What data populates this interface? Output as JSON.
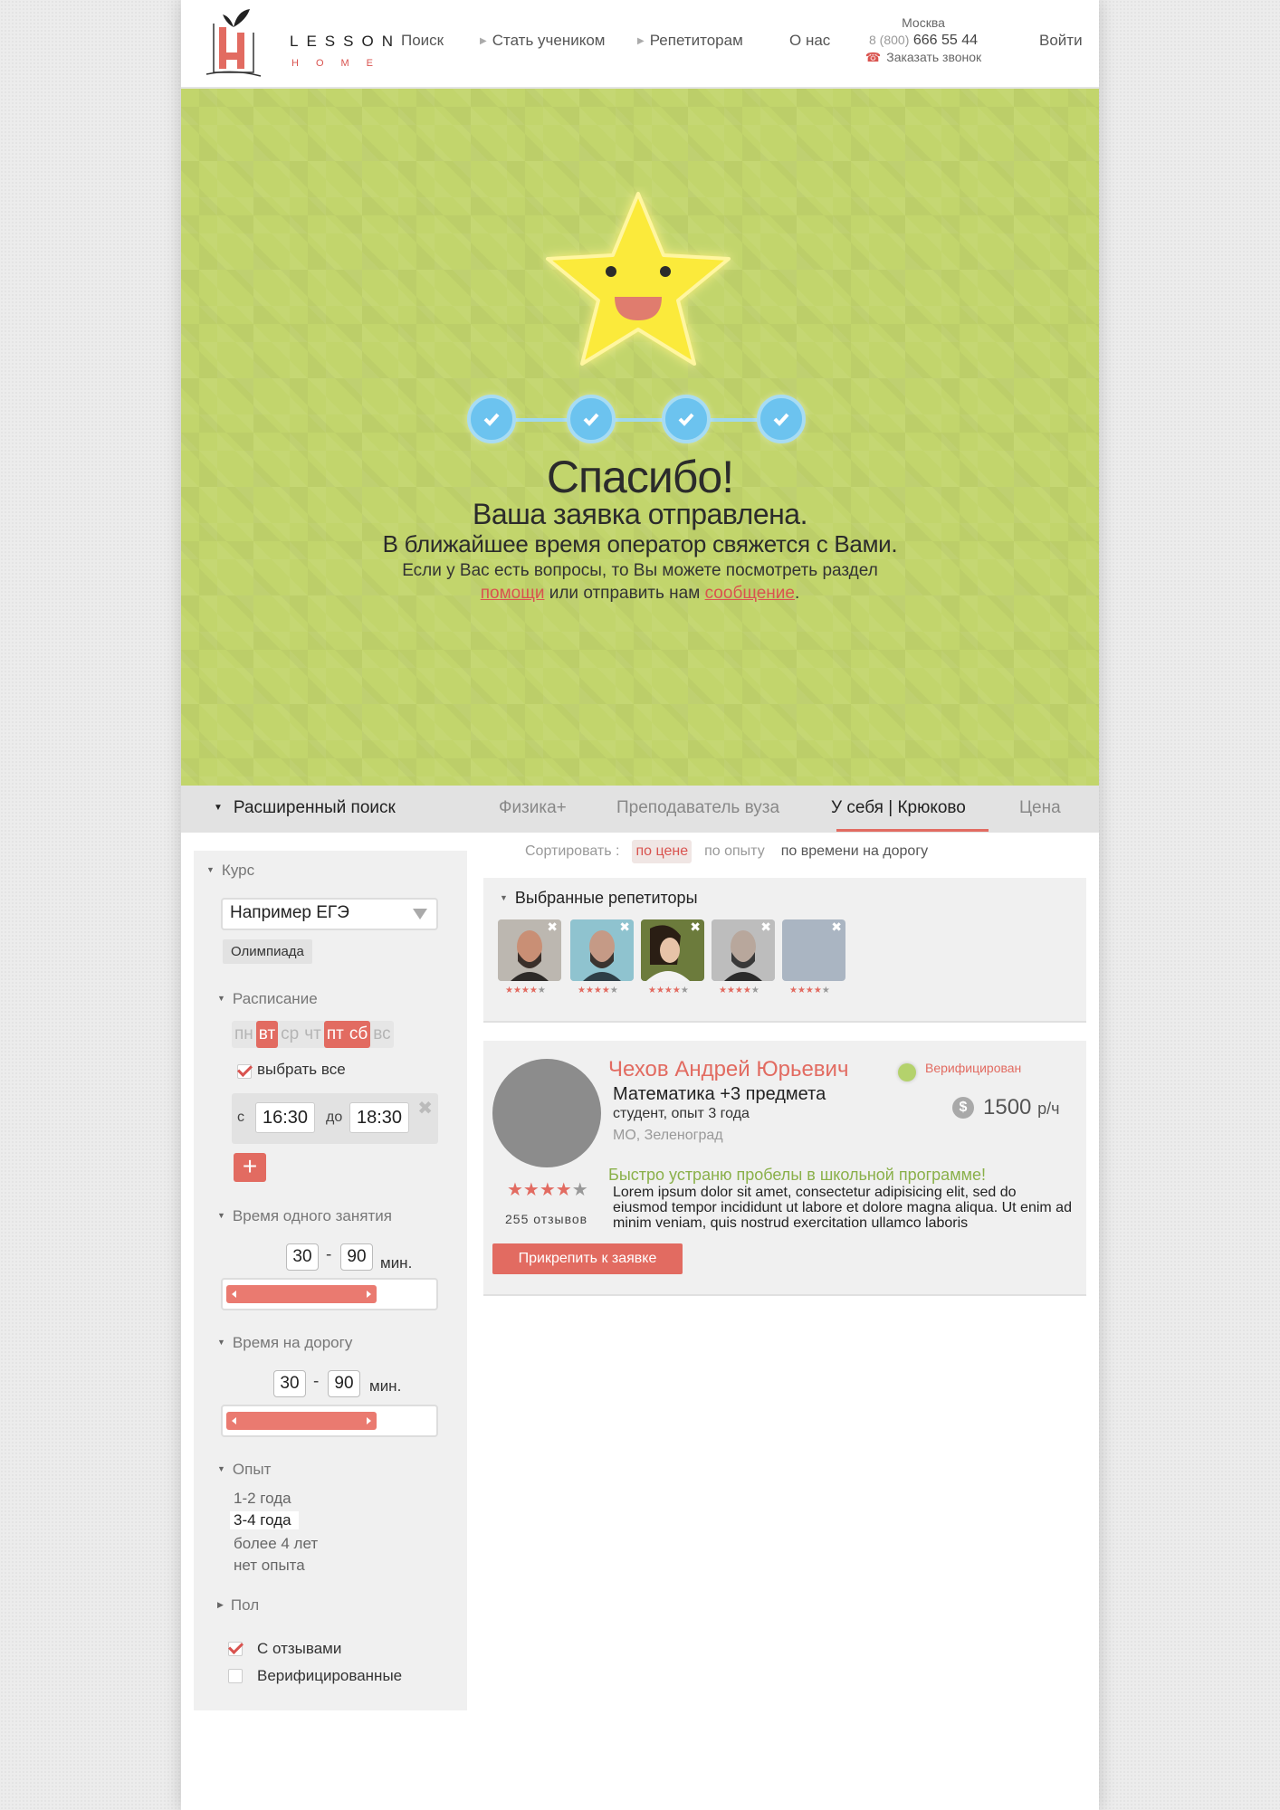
{
  "header": {
    "logo_line1": "LESSON",
    "logo_line2": "HOME",
    "nav": {
      "search": "Поиск",
      "become_student": "Стать учеником",
      "tutors": "Репетиторам",
      "about": "О нас",
      "login": "Войти"
    },
    "contact": {
      "city": "Москва",
      "phone_prefix": "8 (800)",
      "phone_number": "666 55 44",
      "callback": "Заказать звонок"
    }
  },
  "hero": {
    "progress_steps_completed": 4,
    "progress_steps_total": 4,
    "title": "Спасибо!",
    "subtitle": "Ваша заявка отправлена.",
    "subtitle2": "В ближайшее время оператор свяжется с Вами.",
    "help_line1": "Если у Вас есть вопросы, то Вы можете посмотреть раздел",
    "help_link1": "помощи",
    "help_mid": "или отправить нам",
    "help_link2": "сообщение",
    "help_end": "."
  },
  "searchbar": {
    "advanced": "Расширенный поиск",
    "filter1": "Физика+",
    "filter2": "Преподаватель вуза",
    "filter3": "У себя | Крюково",
    "filter4": "Цена"
  },
  "sort": {
    "label": "Сортировать :",
    "options": [
      "по цене",
      "по опыту",
      "по времени на дорогу"
    ],
    "selected": "по цене"
  },
  "sidebar": {
    "course_title": "Курс",
    "course_value": "Например ЕГЭ",
    "course_chip": "Олимпиада",
    "schedule_title": "Расписание",
    "days": [
      "пн",
      "вт",
      "ср",
      "чт",
      "пт",
      "сб",
      "вс"
    ],
    "days_selected": [
      "вт",
      "пт",
      "сб"
    ],
    "select_all": "выбрать все",
    "select_all_checked": true,
    "time_from_label": "с",
    "time_from": "16:30",
    "time_to_label": "до",
    "time_to": "18:30",
    "add_label": "+",
    "lesson_time_title": "Время одного занятия",
    "lesson_min": "30",
    "lesson_max": "90",
    "lesson_unit": "мин.",
    "travel_title": "Время на дорогу",
    "travel_min": "30",
    "travel_max": "90",
    "travel_unit": "мин.",
    "experience_title": "Опыт",
    "experience_options": [
      "1-2 года",
      "3-4 года",
      "более 4 лет",
      "нет опыта"
    ],
    "experience_selected": "3-4 года",
    "gender_title": "Пол",
    "with_reviews": "С отзывами",
    "with_reviews_checked": true,
    "verified": "Верифицированные",
    "verified_checked": false
  },
  "selected_tutors": {
    "title": "Выбранные репетиторы",
    "count": 5,
    "rating_each": 4,
    "rating_max": 5
  },
  "tutor_card": {
    "name": "Чехов Андрей Юрьевич",
    "verified": "Верифицирован",
    "subjects": "Математика +3 предмета",
    "info": "студент, опыт 3 года",
    "location": "МО, Зеленоград",
    "price": "1500",
    "price_unit": "р/ч",
    "currency_icon": "$",
    "rating": 4,
    "rating_max": 5,
    "reviews": "255 отзывов",
    "promo": "Быстро устраню пробелы в школьной программе!",
    "description": "Lorem ipsum dolor sit amet, consectetur adipisicing elit, sed do eiusmod tempor incididunt ut labore et dolore magna aliqua. Ut enim ad minim veniam, quis nostrud exercitation ullamco laboris",
    "attach_button": "Прикрепить к заявке"
  },
  "colors": {
    "accent": "#e26b61",
    "hero_bg": "#c2d56c",
    "step_blue": "#6cc3ef",
    "verified_green": "#b4d26c"
  }
}
